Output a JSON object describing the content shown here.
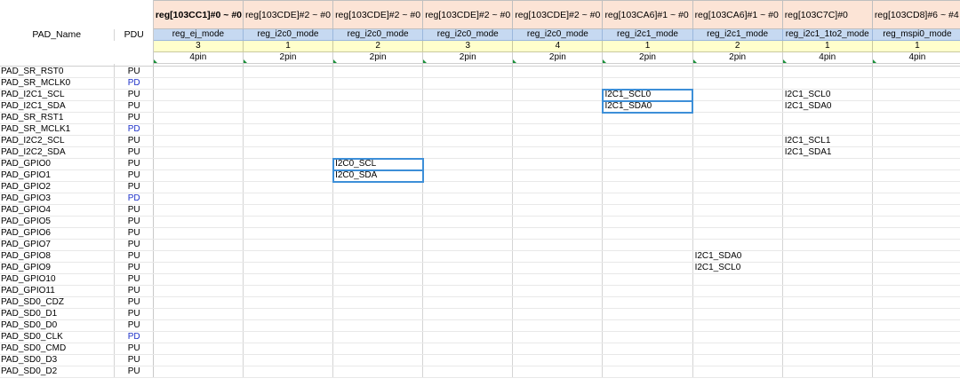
{
  "headers": {
    "pad_name": "PAD_Name",
    "pdu": "PDU",
    "columns": [
      {
        "reg": "reg[103CC1]#0 ~ #0",
        "mode": "reg_ej_mode",
        "val": "3",
        "pin": "4pin"
      },
      {
        "reg": "reg[103CDE]#2 ~ #0",
        "mode": "reg_i2c0_mode",
        "val": "1",
        "pin": "2pin"
      },
      {
        "reg": "reg[103CDE]#2 ~ #0",
        "mode": "reg_i2c0_mode",
        "val": "2",
        "pin": "2pin"
      },
      {
        "reg": "reg[103CDE]#2 ~ #0",
        "mode": "reg_i2c0_mode",
        "val": "3",
        "pin": "2pin"
      },
      {
        "reg": "reg[103CDE]#2 ~ #0",
        "mode": "reg_i2c0_mode",
        "val": "4",
        "pin": "2pin"
      },
      {
        "reg": "reg[103CA6]#1 ~ #0",
        "mode": "reg_i2c1_mode",
        "val": "1",
        "pin": "2pin"
      },
      {
        "reg": "reg[103CA6]#1 ~ #0",
        "mode": "reg_i2c1_mode",
        "val": "2",
        "pin": "2pin"
      },
      {
        "reg": "reg[103C7C]#0",
        "mode": "reg_i2c1_1to2_mode",
        "val": "1",
        "pin": "4pin"
      },
      {
        "reg": "reg[103CD8]#6 ~ #4",
        "mode": "reg_mspi0_mode",
        "val": "1",
        "pin": "4pin"
      }
    ]
  },
  "rows": [
    {
      "pad": "PAD_SR_RST0",
      "pdu": "PU",
      "cells": [
        "",
        "",
        "",
        "",
        "",
        "",
        "",
        "",
        ""
      ]
    },
    {
      "pad": "PAD_SR_MCLK0",
      "pdu": "PD",
      "cells": [
        "",
        "",
        "",
        "",
        "",
        "",
        "",
        "",
        ""
      ]
    },
    {
      "pad": "PAD_I2C1_SCL",
      "pdu": "PU",
      "cells": [
        "",
        "",
        "",
        "",
        "",
        "I2C1_SCL0",
        "",
        "I2C1_SCL0",
        ""
      ]
    },
    {
      "pad": "PAD_I2C1_SDA",
      "pdu": "PU",
      "cells": [
        "",
        "",
        "",
        "",
        "",
        "I2C1_SDA0",
        "",
        "I2C1_SDA0",
        ""
      ]
    },
    {
      "pad": "PAD_SR_RST1",
      "pdu": "PU",
      "cells": [
        "",
        "",
        "",
        "",
        "",
        "",
        "",
        "",
        ""
      ]
    },
    {
      "pad": "PAD_SR_MCLK1",
      "pdu": "PD",
      "cells": [
        "",
        "",
        "",
        "",
        "",
        "",
        "",
        "",
        ""
      ]
    },
    {
      "pad": "PAD_I2C2_SCL",
      "pdu": "PU",
      "cells": [
        "",
        "",
        "",
        "",
        "",
        "",
        "",
        "I2C1_SCL1",
        ""
      ]
    },
    {
      "pad": "PAD_I2C2_SDA",
      "pdu": "PU",
      "cells": [
        "",
        "",
        "",
        "",
        "",
        "",
        "",
        "I2C1_SDA1",
        ""
      ]
    },
    {
      "pad": "PAD_GPIO0",
      "pdu": "PU",
      "cells": [
        "",
        "",
        "I2C0_SCL",
        "",
        "",
        "",
        "",
        "",
        ""
      ]
    },
    {
      "pad": "PAD_GPIO1",
      "pdu": "PU",
      "cells": [
        "",
        "",
        "I2C0_SDA",
        "",
        "",
        "",
        "",
        "",
        ""
      ]
    },
    {
      "pad": "PAD_GPIO2",
      "pdu": "PU",
      "cells": [
        "",
        "",
        "",
        "",
        "",
        "",
        "",
        "",
        ""
      ]
    },
    {
      "pad": "PAD_GPIO3",
      "pdu": "PD",
      "cells": [
        "",
        "",
        "",
        "",
        "",
        "",
        "",
        "",
        ""
      ]
    },
    {
      "pad": "PAD_GPIO4",
      "pdu": "PU",
      "cells": [
        "",
        "",
        "",
        "",
        "",
        "",
        "",
        "",
        ""
      ]
    },
    {
      "pad": "PAD_GPIO5",
      "pdu": "PU",
      "cells": [
        "",
        "",
        "",
        "",
        "",
        "",
        "",
        "",
        ""
      ]
    },
    {
      "pad": "PAD_GPIO6",
      "pdu": "PU",
      "cells": [
        "",
        "",
        "",
        "",
        "",
        "",
        "",
        "",
        ""
      ]
    },
    {
      "pad": "PAD_GPIO7",
      "pdu": "PU",
      "cells": [
        "",
        "",
        "",
        "",
        "",
        "",
        "",
        "",
        ""
      ]
    },
    {
      "pad": "PAD_GPIO8",
      "pdu": "PU",
      "cells": [
        "",
        "",
        "",
        "",
        "",
        "",
        "I2C1_SDA0",
        "",
        ""
      ]
    },
    {
      "pad": "PAD_GPIO9",
      "pdu": "PU",
      "cells": [
        "",
        "",
        "",
        "",
        "",
        "",
        "I2C1_SCL0",
        "",
        ""
      ]
    },
    {
      "pad": "PAD_GPIO10",
      "pdu": "PU",
      "cells": [
        "",
        "",
        "",
        "",
        "",
        "",
        "",
        "",
        ""
      ]
    },
    {
      "pad": "PAD_GPIO11",
      "pdu": "PU",
      "cells": [
        "",
        "",
        "",
        "",
        "",
        "",
        "",
        "",
        ""
      ]
    },
    {
      "pad": "PAD_SD0_CDZ",
      "pdu": "PU",
      "cells": [
        "",
        "",
        "",
        "",
        "",
        "",
        "",
        "",
        ""
      ]
    },
    {
      "pad": "PAD_SD0_D1",
      "pdu": "PU",
      "cells": [
        "",
        "",
        "",
        "",
        "",
        "",
        "",
        "",
        ""
      ]
    },
    {
      "pad": "PAD_SD0_D0",
      "pdu": "PU",
      "cells": [
        "",
        "",
        "",
        "",
        "",
        "",
        "",
        "",
        ""
      ]
    },
    {
      "pad": "PAD_SD0_CLK",
      "pdu": "PD",
      "cells": [
        "",
        "",
        "",
        "",
        "",
        "",
        "",
        "",
        ""
      ]
    },
    {
      "pad": "PAD_SD0_CMD",
      "pdu": "PU",
      "cells": [
        "",
        "",
        "",
        "",
        "",
        "",
        "",
        "",
        ""
      ]
    },
    {
      "pad": "PAD_SD0_D3",
      "pdu": "PU",
      "cells": [
        "",
        "",
        "",
        "",
        "",
        "",
        "",
        "",
        ""
      ]
    },
    {
      "pad": "PAD_SD0_D2",
      "pdu": "PU",
      "cells": [
        "",
        "",
        "",
        "",
        "",
        "",
        "",
        "",
        ""
      ]
    }
  ],
  "bold_header_columns": [
    0
  ],
  "selections": [
    {
      "col": 5,
      "rows": [
        2,
        3
      ]
    },
    {
      "col": 2,
      "rows": [
        8,
        9
      ]
    }
  ],
  "colors": {
    "reg_header_bg": "#fce4d6",
    "mode_header_bg": "#c6d9f1",
    "value_row_bg": "#ffffcc",
    "pd_text": "#1c30c8",
    "selection_border": "#3d8fd8"
  }
}
